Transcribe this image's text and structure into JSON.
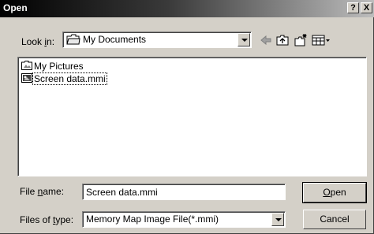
{
  "window": {
    "title": "Open",
    "help_button": "?",
    "close_button": "X"
  },
  "look_in": {
    "label_pre": "Look ",
    "label_accel": "i",
    "label_post": "n:",
    "value": "My Documents",
    "icon": "folder-icon"
  },
  "toolbar": {
    "back_icon": "back-arrow-icon",
    "up_icon": "up-folder-icon",
    "new_folder_icon": "new-folder-icon",
    "view_icon": "view-menu-icon"
  },
  "files": [
    {
      "name": "My Pictures",
      "icon": "folder-icon",
      "selected": false
    },
    {
      "name": "Screen data.mmi",
      "icon": "image-file-icon",
      "selected": true
    }
  ],
  "file_name": {
    "label_pre": "File ",
    "label_accel": "n",
    "label_post": "ame:",
    "value": "Screen data.mmi"
  },
  "file_type": {
    "label_pre": "Files of ",
    "label_accel": "t",
    "label_post": "ype:",
    "value": "Memory Map Image File(*.mmi)"
  },
  "buttons": {
    "open_accel": "O",
    "open_rest": "pen",
    "cancel": "Cancel"
  }
}
